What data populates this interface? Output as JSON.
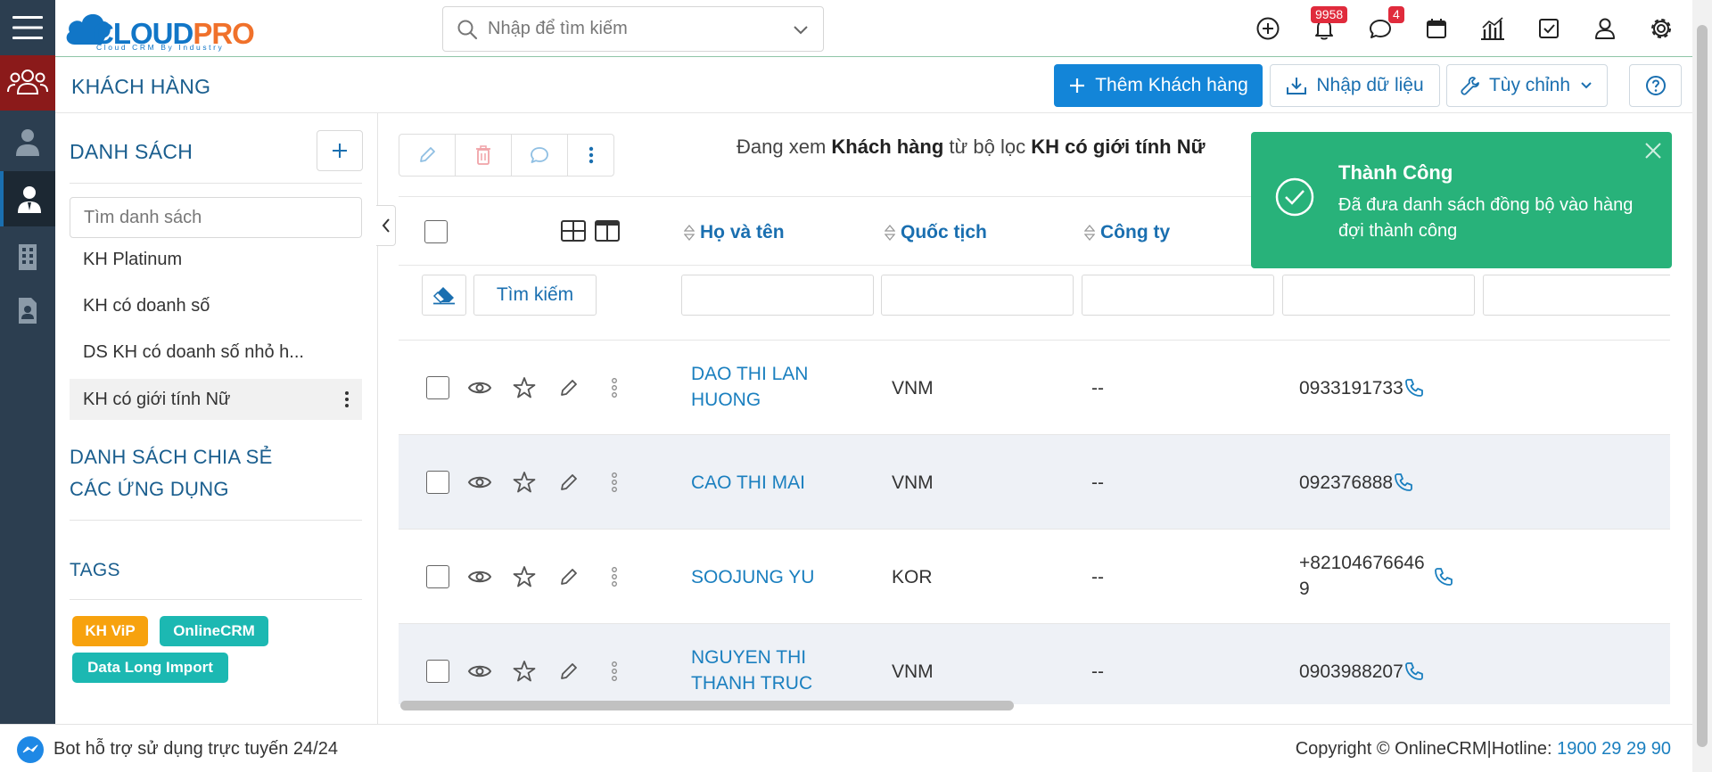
{
  "app": {
    "logo_text_cloud": "CLOUD",
    "logo_text_pro": "PRO",
    "logo_tagline": "Cloud CRM By Industry",
    "search_placeholder": "Nhập để tìm kiếm",
    "notifications_count": "9958",
    "messages_count": "4",
    "colors": {
      "primary": "#1385d8",
      "sidebar": "#2c3e50",
      "success": "#28b27a",
      "brand_orange": "#f0712b",
      "active_module": "#8b1a1a"
    }
  },
  "page": {
    "title": "KHÁCH HÀNG",
    "add_button": "Thêm Khách hàng",
    "import_button": "Nhập dữ liệu",
    "customize_button": "Tùy chỉnh"
  },
  "list_panel": {
    "title": "DANH SÁCH",
    "search_placeholder": "Tìm danh sách",
    "items": [
      {
        "label": "KH Platinum"
      },
      {
        "label": "KH có doanh số"
      },
      {
        "label": "DS KH có doanh số nhỏ h..."
      },
      {
        "label": "KH có giới tính Nữ",
        "active": true
      }
    ],
    "shared_lists": "DANH SÁCH CHIA SẺ",
    "apps": "CÁC ỨNG DỤNG",
    "tags_title": "TAGS",
    "tags": [
      {
        "label": "KH ViP",
        "color": "#f7a20e"
      },
      {
        "label": "OnlineCRM",
        "color": "#1cb8b2"
      },
      {
        "label": "Data Long Import",
        "color": "#1cb8b2"
      }
    ]
  },
  "main": {
    "viewing_prefix": "Đang xem ",
    "viewing_module": "Khách hàng",
    "viewing_mid": " từ bộ lọc ",
    "viewing_filter": "KH có giới tính Nữ",
    "search_button": "Tìm kiếm",
    "columns": [
      "Họ và tên",
      "Quốc tịch",
      "Công ty"
    ],
    "rows": [
      {
        "name": "DAO THI LAN HUONG",
        "nationality": "VNM",
        "company": "--",
        "phone": "0933191733"
      },
      {
        "name": "CAO THI MAI",
        "nationality": "VNM",
        "company": "--",
        "phone": "092376888"
      },
      {
        "name": "SOOJUNG YU",
        "nationality": "KOR",
        "company": "--",
        "phone": "+821046766469"
      },
      {
        "name": "NGUYEN THI THANH TRUC",
        "nationality": "VNM",
        "company": "--",
        "phone": "0903988207"
      }
    ]
  },
  "toast": {
    "title": "Thành Công",
    "message": "Đã đưa danh sách đồng bộ vào hàng đợi thành công"
  },
  "footer": {
    "bot_text": "Bot hỗ trợ sử dụng trực tuyến 24/24",
    "copyright": "Copyright © OnlineCRM",
    "separator": "|",
    "hotline_label": "Hotline: ",
    "hotline": "1900 29 29 90"
  }
}
